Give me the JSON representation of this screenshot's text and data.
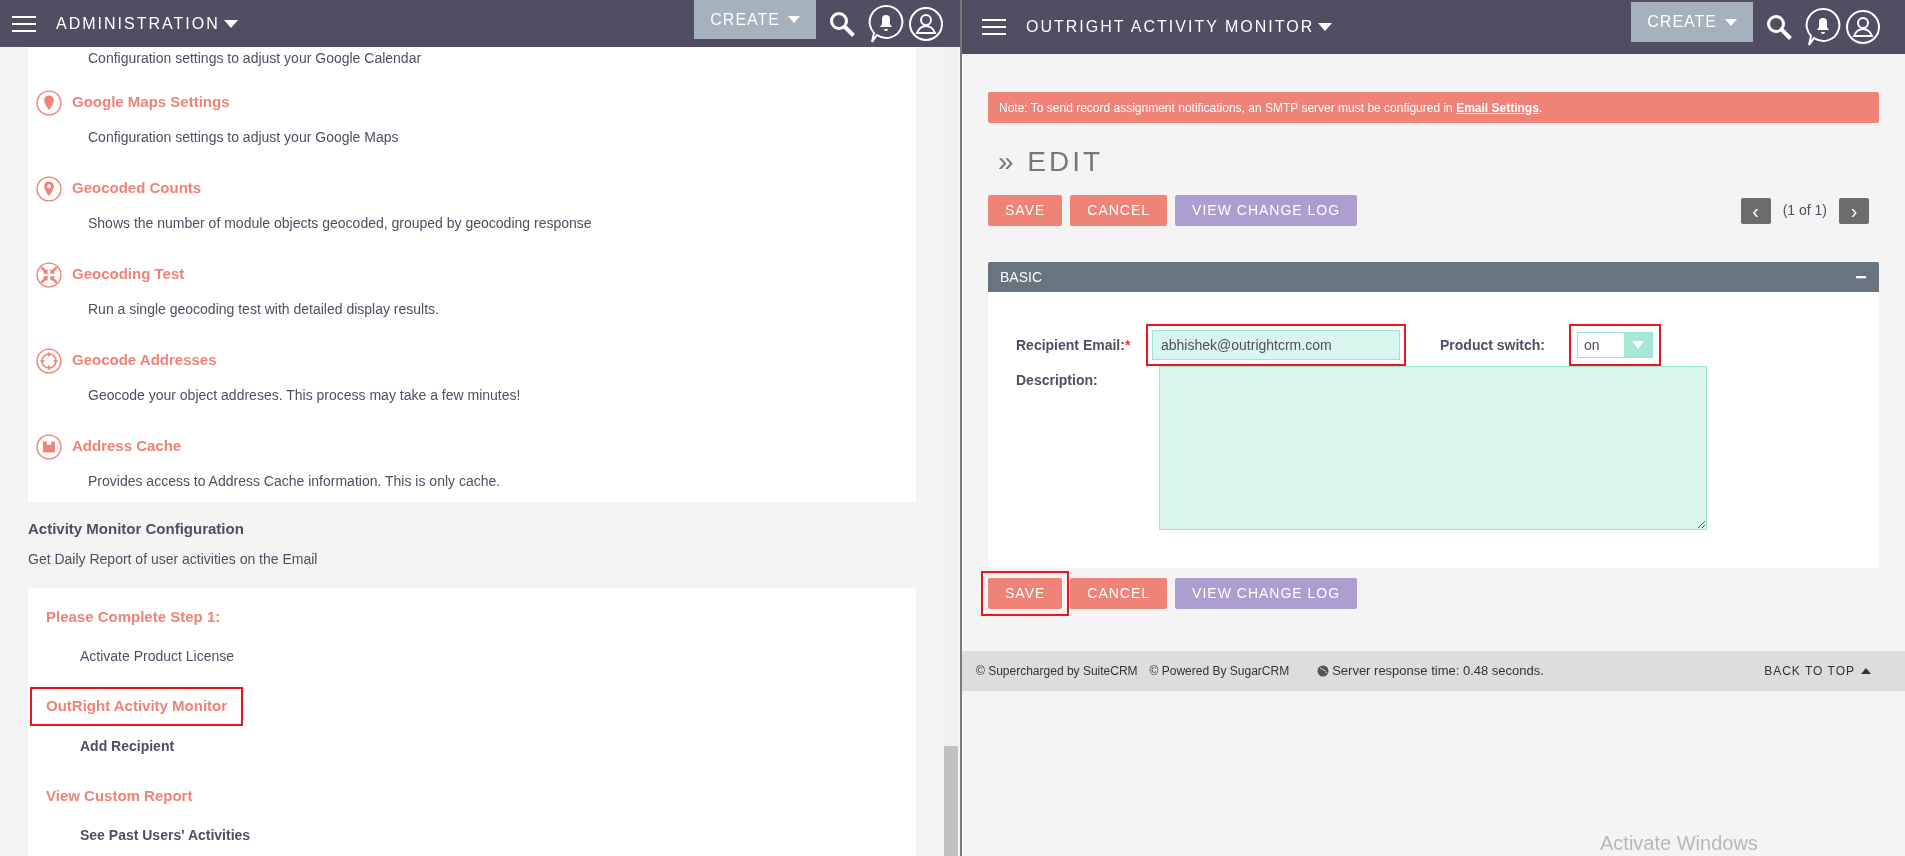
{
  "left_pane": {
    "header": {
      "module_title": "ADMINISTRATION",
      "create_button": "CREATE"
    },
    "settings_items": [
      {
        "description": "Configuration settings to adjust your Google Calendar"
      },
      {
        "kind": "pin",
        "title": "Google Maps Settings",
        "description": "Configuration settings to adjust your Google Maps"
      },
      {
        "kind": "pin-star",
        "title": "Geocoded Counts",
        "description": "Shows the number of module objects geocoded, grouped by geocoding response"
      },
      {
        "kind": "arrows",
        "title": "Geocoding Test",
        "description": "Run a single geocoding test with detailed display results."
      },
      {
        "kind": "target",
        "title": "Geocode Addresses",
        "description": "Geocode your object addreses. This process may take a few minutes!"
      },
      {
        "kind": "box",
        "title": "Address Cache",
        "description": "Provides access to Address Cache information. This is only cache."
      }
    ],
    "section": {
      "title": "Activity Monitor Configuration",
      "subtitle": "Get Daily Report of user activities on the Email"
    },
    "activity_items": [
      {
        "title": "Please Complete Step 1:",
        "link": "Activate Product License",
        "highlighted": false,
        "bold_link": false
      },
      {
        "title": "OutRight Activity Monitor",
        "link": "Add Recipient",
        "highlighted": true,
        "bold_link": true
      },
      {
        "title": "View Custom Report",
        "link": "See Past Users' Activities",
        "highlighted": false,
        "bold_link": true
      }
    ]
  },
  "right_pane": {
    "header": {
      "module_title": "OUTRIGHT ACTIVITY MONITOR",
      "create_button": "CREATE"
    },
    "notice": {
      "text": "Note: To send record assignment notifications, an SMTP server must be configured in ",
      "link": "Email Settings",
      "after": "."
    },
    "page_title": "» EDIT",
    "top_buttons": [
      {
        "kind": "primary",
        "label": "SAVE",
        "highlighted": false
      },
      {
        "kind": "primary",
        "label": "CANCEL",
        "highlighted": false
      },
      {
        "kind": "secondary",
        "label": "VIEW CHANGE LOG",
        "highlighted": false
      }
    ],
    "pagination": {
      "prev": "‹",
      "label": "(1 of 1)",
      "next": "›"
    },
    "panel": {
      "title": "BASIC",
      "collapse": "−",
      "expanded": true,
      "recipient_email": {
        "label": "Recipient Email:",
        "required": "*",
        "value": "abhishek@outrightcrm.com",
        "highlighted": true
      },
      "product_switch": {
        "label": "Product switch:",
        "value": "on",
        "highlighted": true
      },
      "description": {
        "label": "Description:"
      }
    },
    "bottom_buttons": [
      {
        "kind": "primary",
        "label": "SAVE",
        "highlighted": true
      },
      {
        "kind": "primary",
        "label": "CANCEL",
        "highlighted": false
      },
      {
        "kind": "secondary",
        "label": "VIEW CHANGE LOG",
        "highlighted": false
      }
    ],
    "footer": {
      "suitecrm": "© Supercharged by SuiteCRM",
      "sugarcrm": "© Powered By SugarCRM",
      "response_time": "Server response time: 0.48 seconds.",
      "back_to_top": "BACK TO TOP"
    }
  },
  "os_notice": "Activate Windows"
}
